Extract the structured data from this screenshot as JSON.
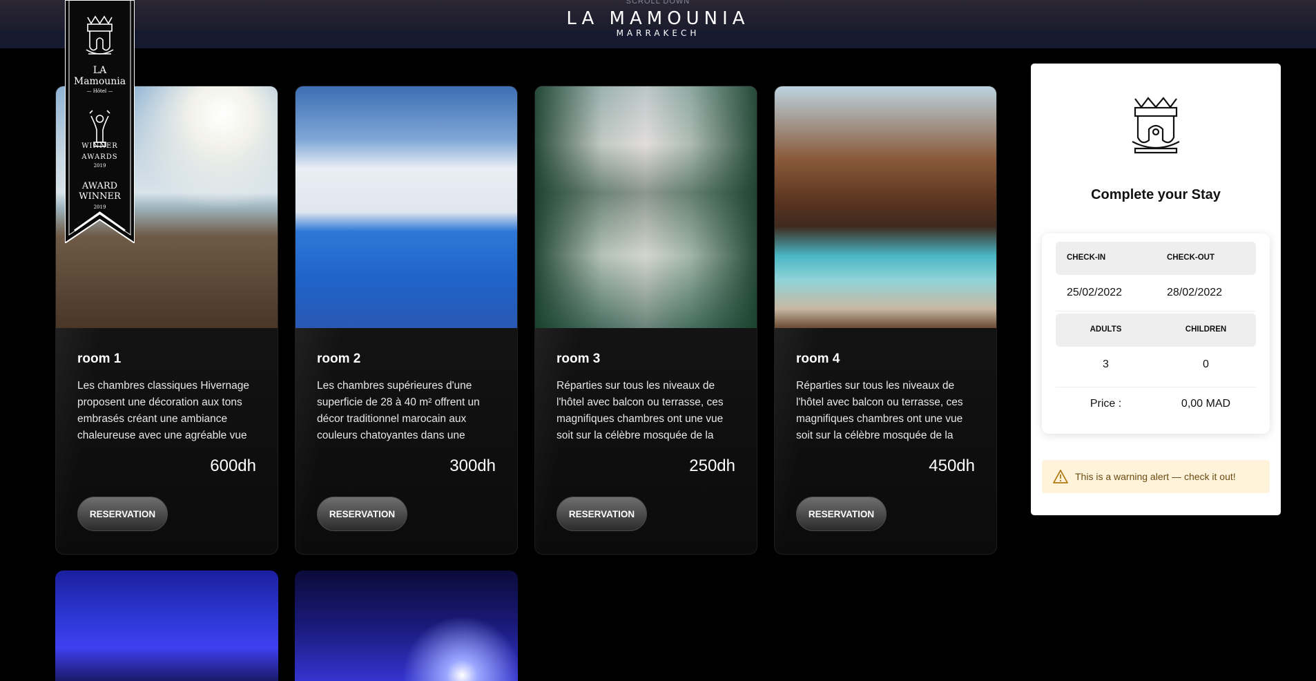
{
  "header": {
    "scroll_hint": "SCROLL DOWN",
    "brand_name": "LA MAMOUNIA",
    "brand_city": "MARRAKECH"
  },
  "ribbon": {
    "hotel_line1": "LA",
    "hotel_line2": "Mamounia",
    "hotel_line3": "— Hôtel —",
    "winner": "WINNER",
    "awards": "AWARDS",
    "year": "2019",
    "award_line1": "AWARD",
    "award_line2": "WINNER",
    "award_year": "2019"
  },
  "rooms": [
    {
      "title": "room 1",
      "description": "Les chambres classiques Hivernage proposent une décoration aux tons embrasés créant une ambiance chaleureuse avec une agréable vue",
      "price": "600dh",
      "button": "RESERVATION"
    },
    {
      "title": "room 2",
      "description": "Les chambres supérieures d'une superficie de 28 à 40 m² offrent un décor traditionnel marocain aux couleurs chatoyantes dans une",
      "price": "300dh",
      "button": "RESERVATION"
    },
    {
      "title": "room 3",
      "description": "Réparties sur tous les niveaux de l'hôtel avec balcon ou terrasse, ces magnifiques chambres ont une vue soit sur la célèbre mosquée de la",
      "price": "250dh",
      "button": "RESERVATION"
    },
    {
      "title": "room 4",
      "description": "Réparties sur tous les niveaux de l'hôtel avec balcon ou terrasse, ces magnifiques chambres ont une vue soit sur la célèbre mosquée de la",
      "price": "450dh",
      "button": "RESERVATION"
    }
  ],
  "panel": {
    "title": "Complete your Stay",
    "checkin_label": "CHECK-IN",
    "checkout_label": "CHECK-OUT",
    "checkin_value": "25/02/2022",
    "checkout_value": "28/02/2022",
    "adults_label": "ADULTS",
    "children_label": "CHILDREN",
    "adults_value": "3",
    "children_value": "0",
    "price_label": "Price :",
    "price_value": "0,00 MAD",
    "alert_text": "This is a warning alert — check it out!"
  },
  "colors": {
    "page_bg": "#000000",
    "panel_bg": "#ffffff",
    "alert_bg": "#fff3dc",
    "alert_text": "#6b4b10"
  }
}
